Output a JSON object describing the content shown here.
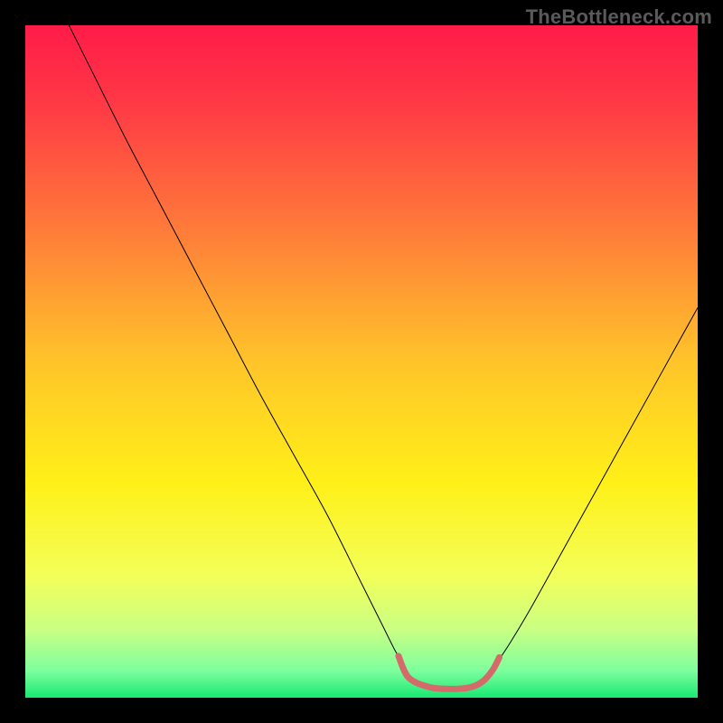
{
  "watermark": "TheBottleneck.com",
  "chart_data": {
    "type": "line",
    "title": "",
    "xlabel": "",
    "ylabel": "",
    "xlim": [
      0,
      100
    ],
    "ylim": [
      0,
      100
    ],
    "grid": false,
    "legend": false,
    "background_gradient": {
      "stops": [
        {
          "offset": 0.0,
          "color": "#ff1b49"
        },
        {
          "offset": 0.12,
          "color": "#ff3a45"
        },
        {
          "offset": 0.3,
          "color": "#ff7a3a"
        },
        {
          "offset": 0.5,
          "color": "#ffc42a"
        },
        {
          "offset": 0.68,
          "color": "#fff018"
        },
        {
          "offset": 0.82,
          "color": "#f3ff5a"
        },
        {
          "offset": 0.9,
          "color": "#c8ff84"
        },
        {
          "offset": 0.96,
          "color": "#7dff9e"
        },
        {
          "offset": 1.0,
          "color": "#18e873"
        }
      ]
    },
    "series": [
      {
        "name": "left-limb",
        "stroke": "#000000",
        "width": 1,
        "x": [
          6.5,
          10,
          15,
          20,
          25,
          30,
          35,
          40,
          45,
          50,
          53,
          55,
          56.5
        ],
        "y": [
          100,
          93,
          83,
          73.5,
          64,
          54.5,
          45,
          36,
          27,
          17,
          11,
          7,
          4.5
        ]
      },
      {
        "name": "right-limb",
        "stroke": "#000000",
        "width": 1,
        "x": [
          70,
          72,
          75,
          80,
          85,
          90,
          95,
          100
        ],
        "y": [
          5,
          8,
          13,
          22,
          31,
          40,
          49,
          58
        ]
      },
      {
        "name": "flat-base-highlight",
        "stroke": "#d46a6a",
        "width": 7,
        "x": [
          55.5,
          57,
          60,
          63,
          66,
          68,
          69.5,
          70.5
        ],
        "y": [
          6.2,
          3.0,
          1.6,
          1.3,
          1.5,
          2.4,
          4.1,
          6.0
        ]
      }
    ],
    "annotations": []
  }
}
